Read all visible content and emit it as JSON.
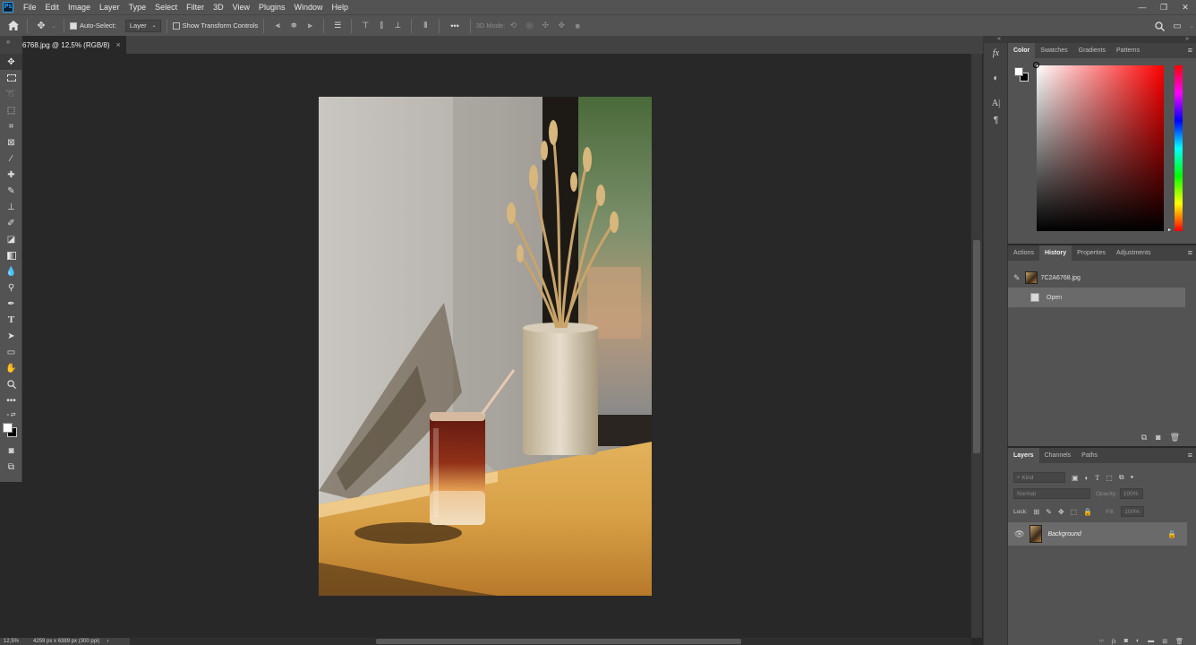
{
  "app": {
    "logo_text": "Ps"
  },
  "menu": [
    "File",
    "Edit",
    "Image",
    "Layer",
    "Type",
    "Select",
    "Filter",
    "3D",
    "View",
    "Plugins",
    "Window",
    "Help"
  ],
  "window_controls": {
    "minimize": "—",
    "restore": "❐",
    "close": "✕"
  },
  "options_bar": {
    "auto_select_label": "Auto-Select:",
    "auto_select_checked": true,
    "auto_select_target": "Layer",
    "transform_controls_label": "Show Transform Controls",
    "transform_controls_checked": false,
    "more_label": "•••",
    "mode_3d_label": "3D Mode:"
  },
  "document": {
    "tab_title": "6768.jpg @ 12,5% (RGB/8)",
    "close_glyph": "×"
  },
  "status": {
    "zoom": "12,5%",
    "dimensions": "4259 px x 6389 px (300 ppi)",
    "arrow": "›"
  },
  "color_panel": {
    "tabs": [
      "Color",
      "Swatches",
      "Gradients",
      "Patterns"
    ],
    "active_tab": "Color",
    "hue_color": "#ff0000",
    "foreground": "#ffffff",
    "background": "#000000"
  },
  "history_panel": {
    "tabs": [
      "Actions",
      "History",
      "Properties",
      "Adjustments"
    ],
    "active_tab": "History",
    "snapshot_name": "7C2A6768.jpg",
    "states": [
      "Open"
    ]
  },
  "layers_panel": {
    "tabs": [
      "Layers",
      "Channels",
      "Paths"
    ],
    "active_tab": "Layers",
    "filter_placeholder": "Kind",
    "blend_mode": "Normal",
    "opacity_label": "Opacity:",
    "opacity_value": "100%",
    "lock_label": "Lock:",
    "fill_label": "Fill:",
    "fill_value": "100%",
    "layers": [
      {
        "name": "Background",
        "visible": true,
        "locked": true
      }
    ]
  }
}
